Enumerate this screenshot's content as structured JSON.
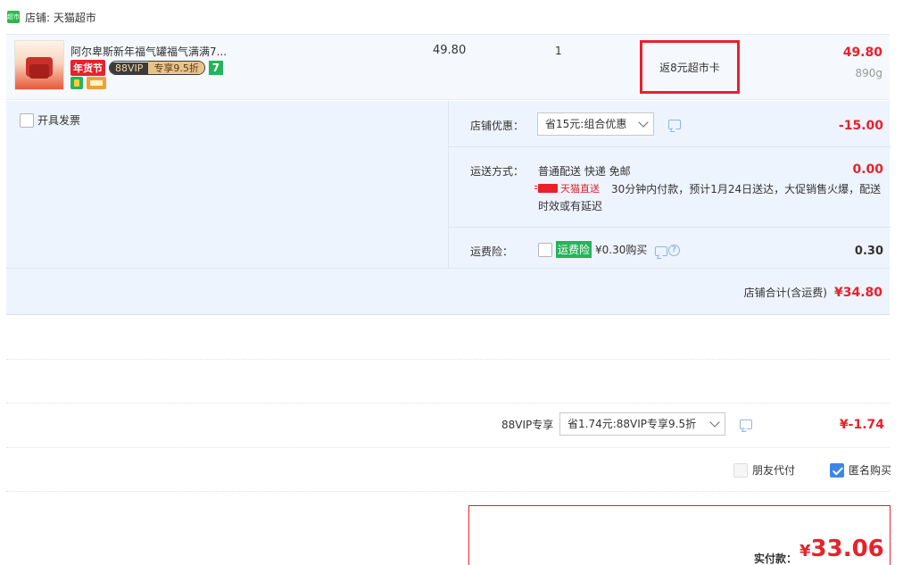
{
  "shop": {
    "icon": "tmall-icon",
    "label": "店铺: 天猫超市"
  },
  "item": {
    "title": "阿尔卑斯新年福气罐福气满满7...",
    "tag_festival": "年货节",
    "tag_vip": "88VIP",
    "tag_vip_discount": "专享9.5折",
    "tag_seven": "7",
    "unit_price": "49.80",
    "quantity": "1",
    "rebate": "返8元超市卡",
    "line_price": "49.80",
    "weight": "890g"
  },
  "invoice": {
    "label": "开具发票"
  },
  "shop_discount": {
    "label": "店铺优惠：",
    "selected": "省15元:组合优惠",
    "value": "-15.00"
  },
  "shipping": {
    "label": "运送方式：",
    "method": "普通配送 快递 免邮",
    "tmall_direct": "天猫直送",
    "note": "30分钟内付款，预计1月24日送达，大促销售火爆，配送时效或有延迟",
    "value": "0.00"
  },
  "insurance": {
    "label": "运费险：",
    "badge": "运费险",
    "price": "¥0.30购买",
    "value": "0.30"
  },
  "shop_total": {
    "label": "店铺合计(含运费)",
    "value": "¥34.80"
  },
  "vip": {
    "label": "88VIP专享",
    "selected": "省1.74元:88VIP专享9.5折",
    "value": "¥-1.74"
  },
  "friend_pay": {
    "label": "朋友代付"
  },
  "anonymous": {
    "label": "匿名购买"
  },
  "pay": {
    "label": "实付款：",
    "currency": "¥",
    "amount": "33.06"
  },
  "colors": {
    "accent_red": "#e8212c",
    "tmall_green": "#27b35a",
    "row_blue": "#eef4fd"
  }
}
